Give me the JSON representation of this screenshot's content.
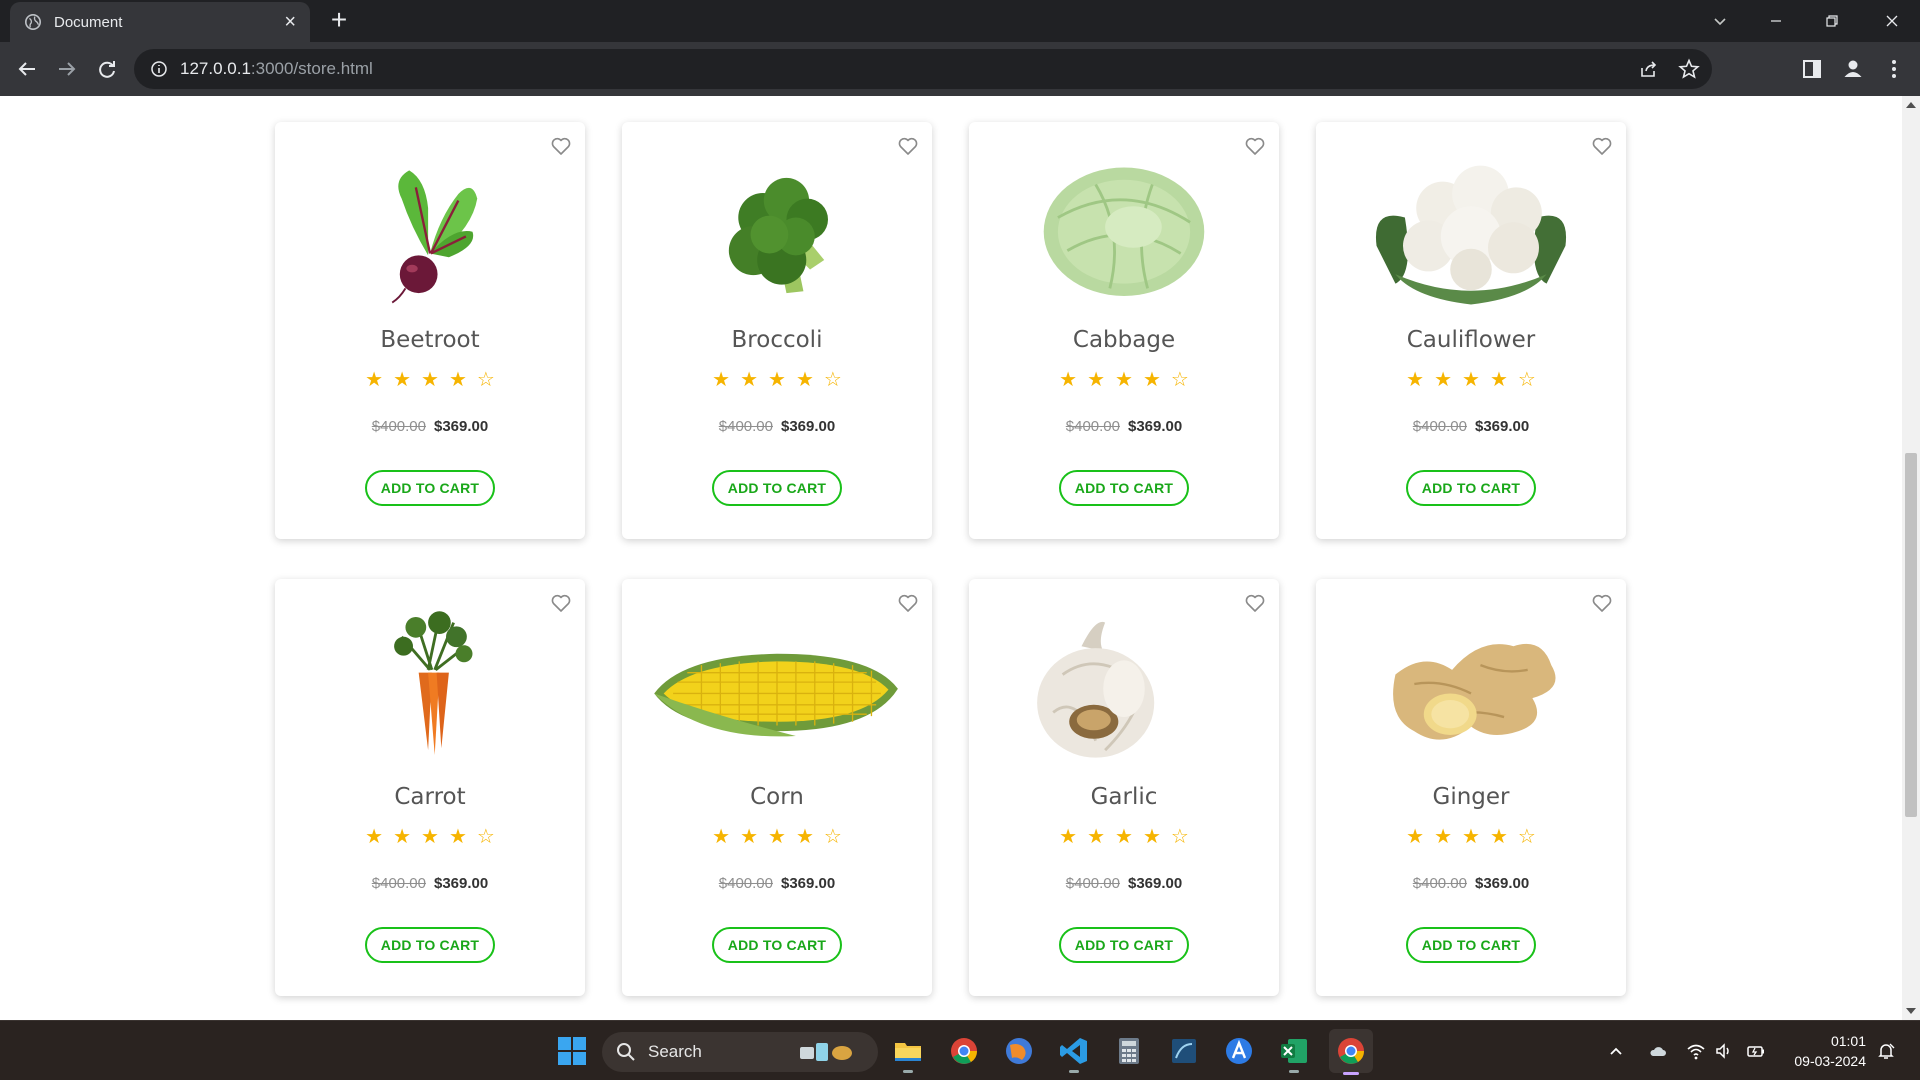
{
  "browser": {
    "tab_title": "Document",
    "url_host": "127.0.0.1",
    "url_path": ":3000/store.html"
  },
  "products": [
    {
      "name": "Beetroot",
      "old_price": "$400.00",
      "price": "$369.00",
      "rating": 4,
      "max_rating": 5,
      "image": "beetroot"
    },
    {
      "name": "Broccoli",
      "old_price": "$400.00",
      "price": "$369.00",
      "rating": 4,
      "max_rating": 5,
      "image": "broccoli"
    },
    {
      "name": "Cabbage",
      "old_price": "$400.00",
      "price": "$369.00",
      "rating": 4,
      "max_rating": 5,
      "image": "cabbage"
    },
    {
      "name": "Cauliflower",
      "old_price": "$400.00",
      "price": "$369.00",
      "rating": 4,
      "max_rating": 5,
      "image": "cauliflower"
    },
    {
      "name": "Carrot",
      "old_price": "$400.00",
      "price": "$369.00",
      "rating": 4,
      "max_rating": 5,
      "image": "carrot"
    },
    {
      "name": "Corn",
      "old_price": "$400.00",
      "price": "$369.00",
      "rating": 4,
      "max_rating": 5,
      "image": "corn"
    },
    {
      "name": "Garlic",
      "old_price": "$400.00",
      "price": "$369.00",
      "rating": 4,
      "max_rating": 5,
      "image": "garlic"
    },
    {
      "name": "Ginger",
      "old_price": "$400.00",
      "price": "$369.00",
      "rating": 4,
      "max_rating": 5,
      "image": "ginger"
    }
  ],
  "labels": {
    "add_to_cart": "ADD TO CART"
  },
  "colors": {
    "star": "#f6b400",
    "button_border": "#19c119",
    "button_text": "#19a719"
  },
  "taskbar": {
    "search_label": "Search",
    "time": "01:01",
    "date": "09-03-2024"
  }
}
